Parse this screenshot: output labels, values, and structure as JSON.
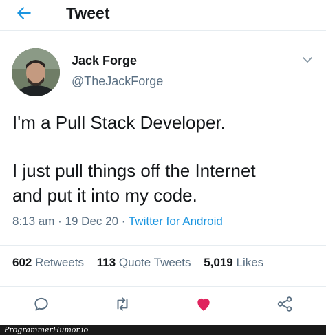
{
  "header": {
    "title": "Tweet",
    "back_icon": "back-arrow-icon"
  },
  "author": {
    "name": "Jack Forge",
    "handle": "@TheJackForge"
  },
  "tweet": {
    "line1": "I'm a Pull Stack Developer.",
    "line2": "I just pull things off the Internet",
    "line3": "and put it into my code."
  },
  "meta": {
    "time": "8:13 am",
    "sep1": " · ",
    "date": "19 Dec 20",
    "sep2": " · ",
    "source": "Twitter for Android"
  },
  "stats": {
    "retweets_count": "602",
    "retweets_label": "Retweets",
    "quotes_count": "113",
    "quotes_label": "Quote Tweets",
    "likes_count": "5,019",
    "likes_label": "Likes"
  },
  "actions": [
    "reply-icon",
    "retweet-icon",
    "like-icon",
    "share-icon"
  ],
  "colors": {
    "accent": "#1b95e0",
    "like": "#e0245e",
    "muted": "#5b7083",
    "text": "#14171a"
  },
  "watermark": "ProgrammerHumor.io"
}
